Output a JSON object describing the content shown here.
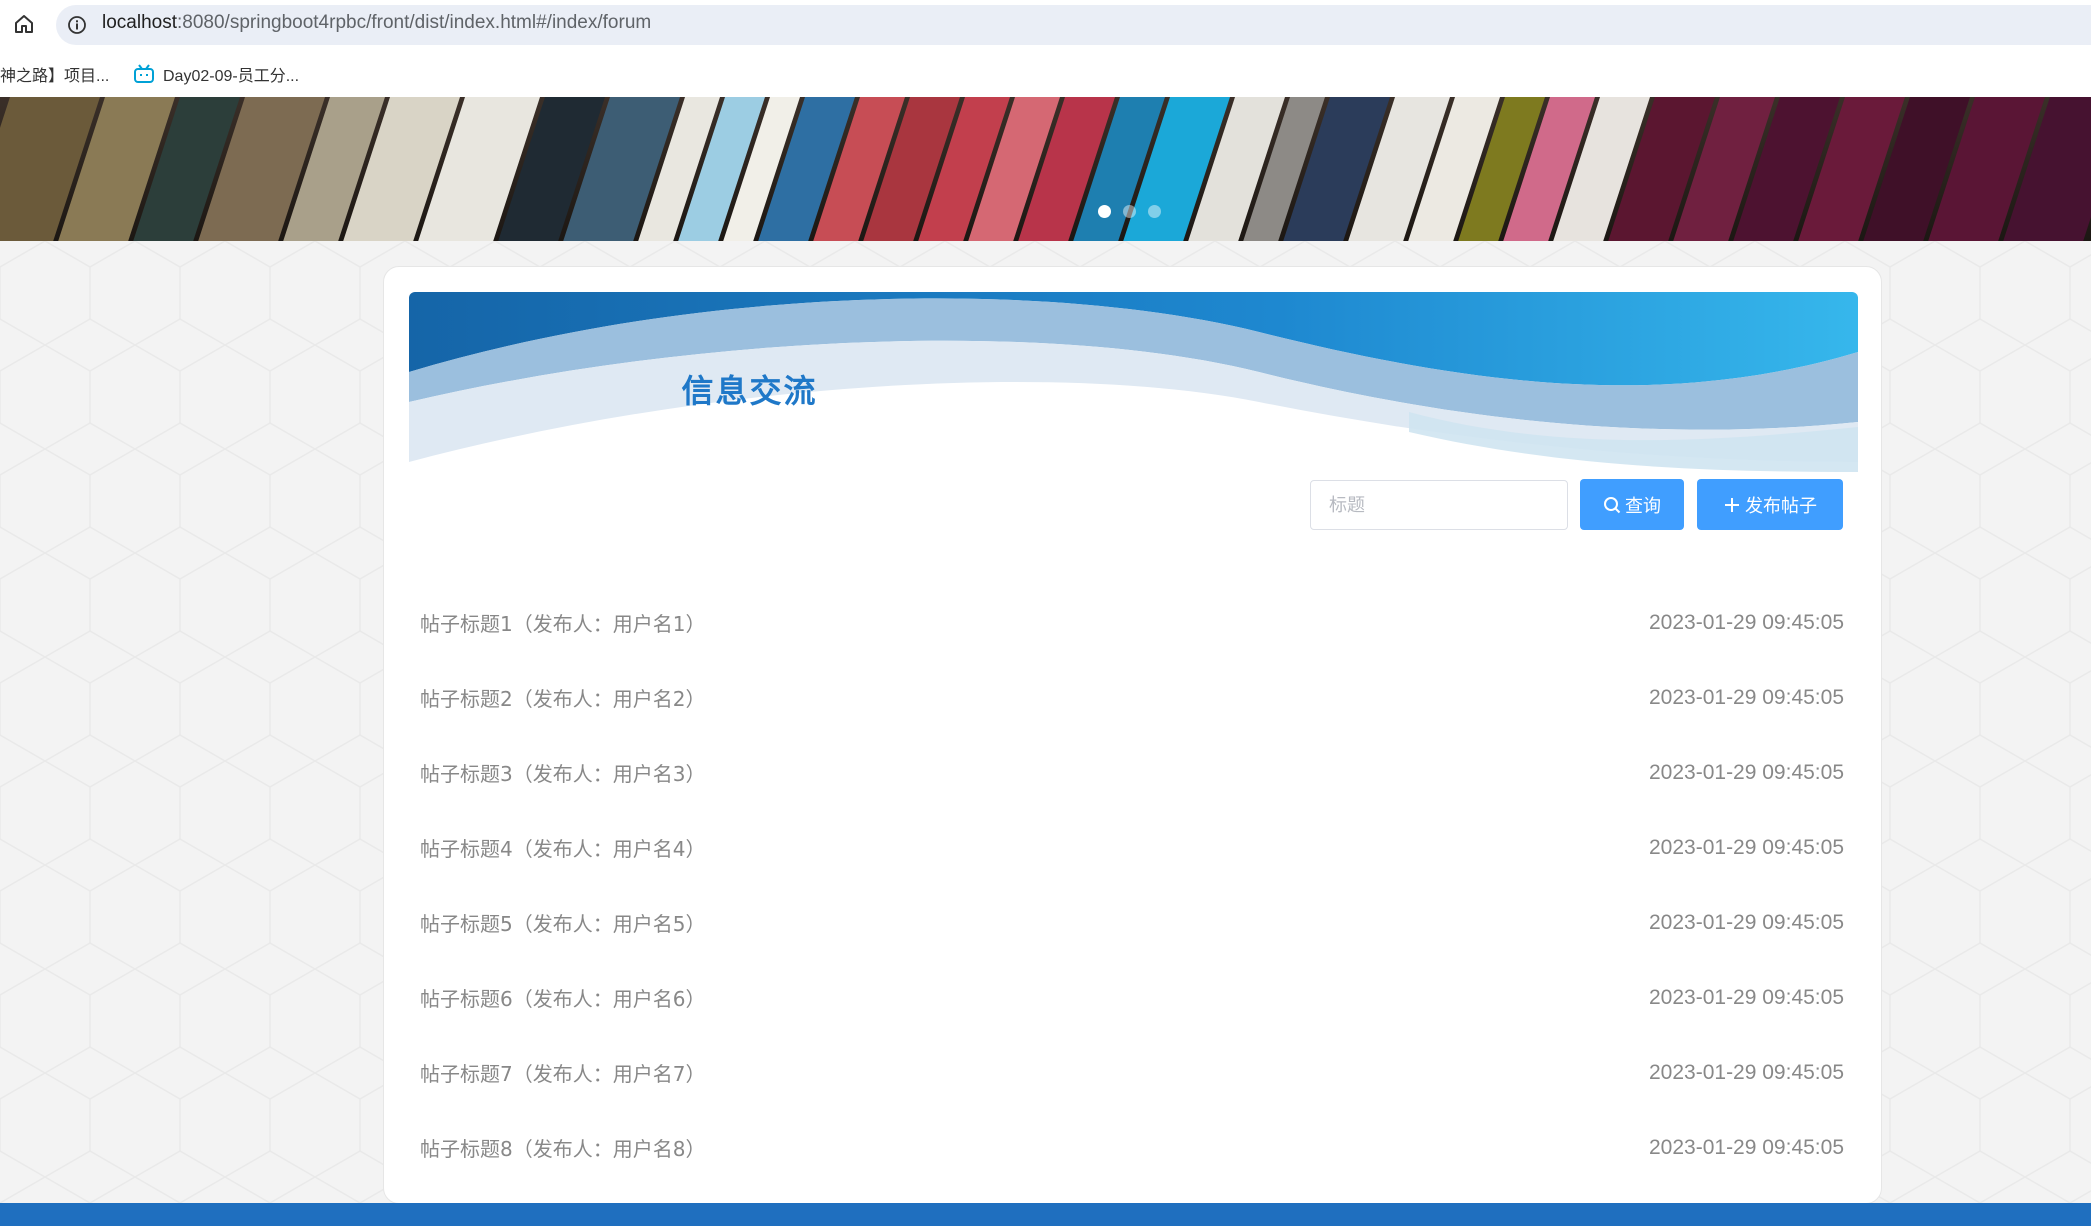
{
  "browser": {
    "url_host": "localhost",
    "url_path": ":8080/springboot4rpbc/front/dist/index.html#/index/forum",
    "bookmarks": [
      {
        "label": "神之路】项目..."
      },
      {
        "label": "Day02-09-员工分..."
      }
    ]
  },
  "banner": {
    "slides": 3,
    "active_slide": 1
  },
  "page": {
    "title": "信息交流"
  },
  "search": {
    "placeholder": "标题",
    "search_button": "查询",
    "post_button": "发布帖子"
  },
  "posts": [
    {
      "title": "帖子标题1（发布人：用户名1）",
      "time": "2023-01-29 09:45:05"
    },
    {
      "title": "帖子标题2（发布人：用户名2）",
      "time": "2023-01-29 09:45:05"
    },
    {
      "title": "帖子标题3（发布人：用户名3）",
      "time": "2023-01-29 09:45:05"
    },
    {
      "title": "帖子标题4（发布人：用户名4）",
      "time": "2023-01-29 09:45:05"
    },
    {
      "title": "帖子标题5（发布人：用户名5）",
      "time": "2023-01-29 09:45:05"
    },
    {
      "title": "帖子标题6（发布人：用户名6）",
      "time": "2023-01-29 09:45:05"
    },
    {
      "title": "帖子标题7（发布人：用户名7）",
      "time": "2023-01-29 09:45:05"
    },
    {
      "title": "帖子标题8（发布人：用户名8）",
      "time": "2023-01-29 09:45:05"
    }
  ],
  "colors": {
    "accent": "#409eff",
    "title": "#1f78c8",
    "footer": "#1f6fbf"
  }
}
